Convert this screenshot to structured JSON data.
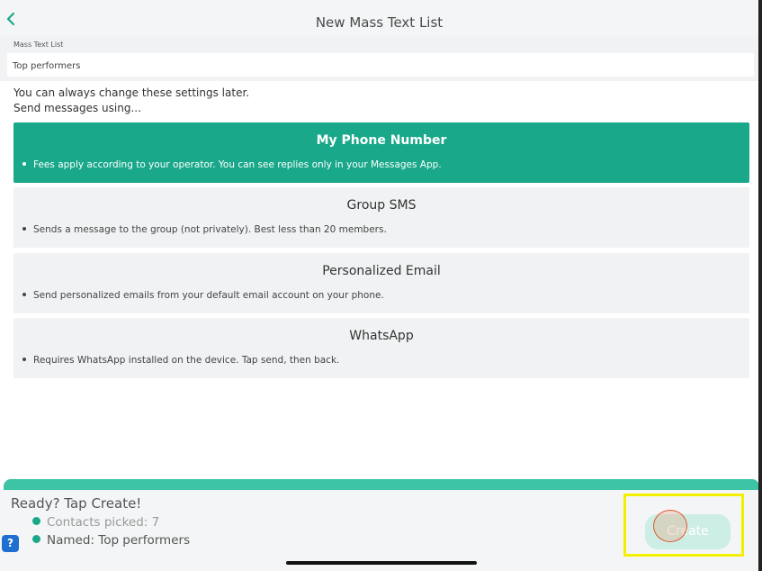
{
  "nav": {
    "title": "New Mass Text List",
    "back_icon": "chevron-left-icon",
    "accent_color": "#1aa88a"
  },
  "list_field": {
    "label": "Mass Text List",
    "value": "Top performers"
  },
  "hints": {
    "line1": "You can always change these settings later.",
    "line2": "Send messages using..."
  },
  "options": [
    {
      "title": "My Phone Number",
      "description": "Fees apply according to your operator. You can see replies only in your Messages App.",
      "selected": true
    },
    {
      "title": "Group SMS",
      "description": "Sends a message to the group (not privately). Best less than 20 members.",
      "selected": false
    },
    {
      "title": "Personalized Email",
      "description": "Send personalized emails from your default email account on your phone.",
      "selected": false
    },
    {
      "title": "WhatsApp",
      "description": "Requires WhatsApp installed on the device. Tap send, then back.",
      "selected": false
    }
  ],
  "footer": {
    "ready_text": "Ready? Tap Create!",
    "contacts_picked": "Contacts picked: 7",
    "named": "Named: Top performers",
    "create_label": "Create",
    "help_icon_label": "?"
  },
  "colors": {
    "selected_bg": "#1aa88a",
    "option_bg": "#f1f2f3",
    "highlight": "#f4ef00"
  }
}
